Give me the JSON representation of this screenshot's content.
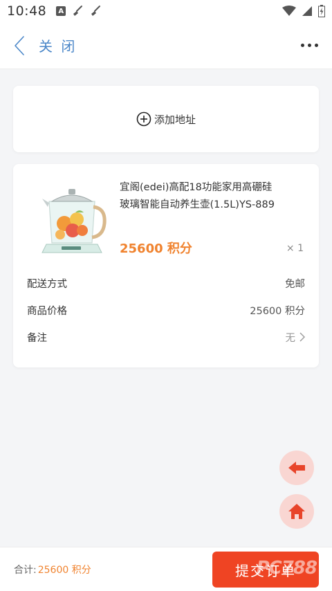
{
  "status_bar": {
    "time": "10:48",
    "left_icons": [
      "a-badge-icon",
      "broom-icon",
      "broom-icon"
    ],
    "right_icons": [
      "wifi-icon",
      "signal-icon",
      "battery-icon"
    ]
  },
  "nav": {
    "back_icon": "chevron-left-icon",
    "close_label": "关 闭",
    "more_icon": "more-dots-icon"
  },
  "address": {
    "add_label": "添加地址",
    "icon": "plus-circle-icon"
  },
  "product": {
    "title": "宜阁(edei)高配18功能家用高硼硅玻璃智能自动养生壶(1.5L)YS-889",
    "price": "25600 积分",
    "quantity": "× 1",
    "image_alt": "kettle-product-image"
  },
  "order_info": {
    "shipping_label": "配送方式",
    "shipping_value": "免邮",
    "price_label": "商品价格",
    "price_value": "25600 积分",
    "remark_label": "备注",
    "remark_value": "无"
  },
  "floating": {
    "back_icon": "arrow-left-icon",
    "home_icon": "home-icon"
  },
  "footer": {
    "total_label": "合计:",
    "total_value": "25600 积分",
    "submit_label": "提交订单"
  },
  "watermark": "PC788",
  "colors": {
    "accent_blue": "#4a86c8",
    "price_orange": "#f0832f",
    "submit_red": "#ef4423",
    "fab_bg": "#f9d6d2",
    "fab_icon": "#e8442a"
  }
}
